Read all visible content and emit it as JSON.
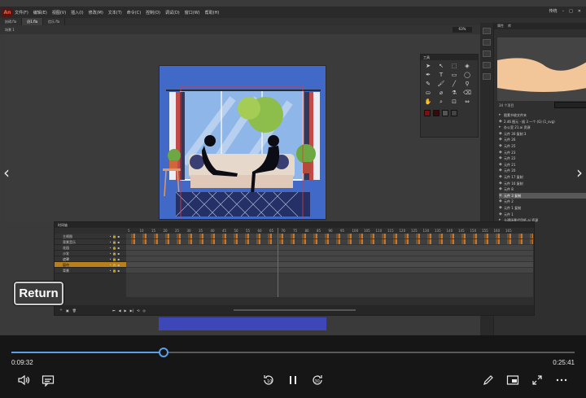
{
  "app": {
    "logo": "An",
    "menu": [
      "文件(F)",
      "编辑(E)",
      "视图(V)",
      "插入(I)",
      "修改(M)",
      "文本(T)",
      "命令(C)",
      "控制(O)",
      "调试(D)",
      "窗口(W)",
      "帮助(H)"
    ],
    "workspace": "传统",
    "tabs": [
      "妨碍.fla",
      "仍1.fla",
      "信乐.fla"
    ],
    "scene": "场景 1",
    "zoom": "63%"
  },
  "tools_panel": {
    "title": "工具",
    "swatch_colors": [
      "#7a1010",
      "#3a0a0a"
    ]
  },
  "library": {
    "tabs": [
      "属性",
      "库"
    ],
    "count": "34 个项目",
    "items": [
      {
        "label": "图素书收文件夹",
        "type": "folder"
      },
      {
        "label": "2.46 图元 - 插 3 一个 (G) (1_svg)",
        "type": "symbol"
      },
      {
        "label": "办公室 21.ai 资源",
        "type": "folder"
      },
      {
        "label": "元件 30 复制 3",
        "type": "symbol"
      },
      {
        "label": "元件 26",
        "type": "symbol"
      },
      {
        "label": "元件 25",
        "type": "symbol"
      },
      {
        "label": "元件 23",
        "type": "symbol"
      },
      {
        "label": "元件 22",
        "type": "symbol"
      },
      {
        "label": "元件 21",
        "type": "symbol"
      },
      {
        "label": "元件 20",
        "type": "symbol"
      },
      {
        "label": "元件 17 复制",
        "type": "symbol"
      },
      {
        "label": "元件 16 复制",
        "type": "symbol"
      },
      {
        "label": "元件 8",
        "type": "symbol"
      },
      {
        "label": "元件 3 复制",
        "type": "symbol",
        "selected": true
      },
      {
        "label": "元件 2",
        "type": "symbol"
      },
      {
        "label": "元件 1 复制",
        "type": "symbol"
      },
      {
        "label": "元件 1",
        "type": "symbol"
      },
      {
        "label": "卡通场景代用纸.ai 资源",
        "type": "folder"
      },
      {
        "label": "卡通场景代用纸.ai",
        "type": "symbol"
      },
      {
        "label": "卡片元素资源.zip",
        "type": "symbol"
      }
    ]
  },
  "timeline": {
    "title": "时间轴",
    "layers": [
      {
        "name": "主视图",
        "selected": false
      },
      {
        "name": "背景音乐",
        "selected": false
      },
      {
        "name": "花园",
        "selected": false
      },
      {
        "name": "沙发",
        "selected": false
      },
      {
        "name": "遮罩",
        "selected": false
      },
      {
        "name": "窗帘",
        "selected": true
      },
      {
        "name": "背景",
        "selected": false
      }
    ],
    "ruler": [
      "5",
      "10",
      "15",
      "20",
      "25",
      "30",
      "35",
      "40",
      "45",
      "50",
      "55",
      "60",
      "65",
      "70",
      "75",
      "80",
      "85",
      "90",
      "95",
      "100",
      "105",
      "110",
      "115",
      "120",
      "125",
      "130",
      "135",
      "140",
      "145",
      "150",
      "155",
      "160",
      "165"
    ],
    "ruler_secs": [
      "1s",
      "2s",
      "3s",
      "4s",
      "5s",
      "6s"
    ]
  },
  "overlay": {
    "return_label": "Return"
  },
  "player": {
    "elapsed": "0:09:32",
    "total": "0:25:41",
    "progress": 0.27,
    "skip_back": "10",
    "skip_forward": "30"
  },
  "colors": {
    "accent": "#5aa0e6",
    "stage": "#4169c7",
    "selected_layer": "#b7801c"
  }
}
